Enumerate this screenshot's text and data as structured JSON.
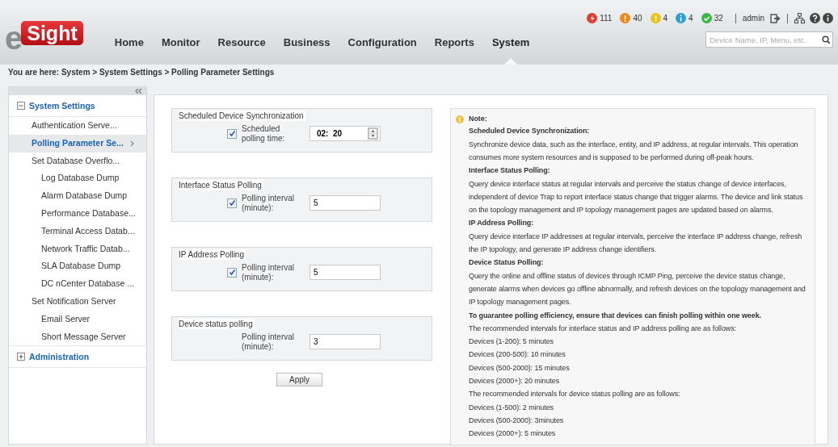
{
  "logo": {
    "prefix": "e",
    "name": "Sight"
  },
  "nav": [
    {
      "label": "Home",
      "selected": false
    },
    {
      "label": "Monitor",
      "selected": false
    },
    {
      "label": "Resource",
      "selected": false
    },
    {
      "label": "Business",
      "selected": false
    },
    {
      "label": "Configuration",
      "selected": false
    },
    {
      "label": "Reports",
      "selected": false
    },
    {
      "label": "System",
      "selected": true
    }
  ],
  "alarms": [
    {
      "kind": "critical",
      "color": "#e03c31",
      "count": "111"
    },
    {
      "kind": "major",
      "color": "#f08a1c",
      "count": "40"
    },
    {
      "kind": "minor",
      "color": "#e8c31c",
      "count": "4"
    },
    {
      "kind": "warning",
      "color": "#2a9fd8",
      "count": "4"
    },
    {
      "kind": "cleared",
      "color": "#3bb54a",
      "count": "32"
    }
  ],
  "user": "admin",
  "search": {
    "placeholder": "Device Name, IP, Menu, etc."
  },
  "breadcrumb": "You are here: System > System Settings > Polling Parameter Settings",
  "sidebar": [
    {
      "label": "System Settings",
      "expanded": true,
      "children": [
        {
          "label": "Authentication Serve...",
          "selected": false
        },
        {
          "label": "Polling Parameter Se...",
          "selected": true
        },
        {
          "label": "Set Database Overflo...",
          "selected": false,
          "children": [
            {
              "label": "Log Database Dump",
              "selected": false
            },
            {
              "label": "Alarm Database Dump",
              "selected": false
            },
            {
              "label": "Performance Database...",
              "selected": false
            },
            {
              "label": "Terminal Access Datab...",
              "selected": false
            },
            {
              "label": "Network Traffic Datab...",
              "selected": false
            },
            {
              "label": "SLA Database Dump",
              "selected": false
            },
            {
              "label": "DC nCenter Database ...",
              "selected": false
            }
          ]
        },
        {
          "label": "Set Notification Server",
          "selected": false,
          "children": [
            {
              "label": "Email Server",
              "selected": false
            },
            {
              "label": "Short Message Server",
              "selected": false
            }
          ]
        }
      ]
    },
    {
      "label": "Administration",
      "expanded": false
    }
  ],
  "groups": [
    {
      "title": "Scheduled Device Synchronization",
      "checked": true,
      "label": "Scheduled polling time:",
      "kind": "spinner",
      "value": "02:  20"
    },
    {
      "title": "Interface Status Polling",
      "checked": true,
      "label": "Polling interval (minute):",
      "kind": "text",
      "value": "5"
    },
    {
      "title": "IP Address Polling",
      "checked": true,
      "label": "Polling interval (minute):",
      "kind": "text",
      "value": "5"
    },
    {
      "title": "Device status polling",
      "label": "Polling interval (minute):",
      "kind": "text",
      "value": "3"
    }
  ],
  "apply": "Apply",
  "note": {
    "title": "Note:",
    "items": [
      {
        "kind": "heading",
        "text": "Scheduled Device Synchronization:"
      },
      {
        "kind": "text",
        "text": "Synchronize device data, such as the interface, entity, and IP address, at regular intervals. This operation consumes more system resources and is supposed to be performed during off-peak hours."
      },
      {
        "kind": "heading",
        "text": "Interface Status Polling:"
      },
      {
        "kind": "text",
        "text": "Query device interface status at regular intervals and perceive the status change of device interfaces, independent of device Trap to report interface status change that trigger alarms. The device and link status on the topology management and IP topology management pages are updated based on alarms."
      },
      {
        "kind": "heading",
        "text": "IP Address Polling:"
      },
      {
        "kind": "text",
        "text": "Query device interface IP addresses at regular intervals, perceive the interface IP address change, refresh the IP topology, and generate IP address change identifiers."
      },
      {
        "kind": "heading",
        "text": "Device Status Polling:"
      },
      {
        "kind": "text",
        "text": "Query the online and offline status of devices through ICMP Ping, perceive the device status change, generate alarms when devices go offline abnormally, and refresh devices on the topology management and IP topology management pages."
      },
      {
        "kind": "heading",
        "text": "To guarantee polling efficiency, ensure that devices can finish polling within one week."
      },
      {
        "kind": "text",
        "text": "The recommended intervals for interface status and IP address polling are as follows:"
      },
      {
        "kind": "text",
        "text": "Devices (1-200): 5 minutes"
      },
      {
        "kind": "text",
        "text": "Devices (200-500): 10 minutes"
      },
      {
        "kind": "text",
        "text": "Devices (500-2000): 15 minutes"
      },
      {
        "kind": "text",
        "text": "Devices (2000+): 20 minutes"
      },
      {
        "kind": "text",
        "text": "The recommended intervals for device status polling are as follows:"
      },
      {
        "kind": "text",
        "text": "Devices (1-500): 2 minutes"
      },
      {
        "kind": "text",
        "text": "Devices (500-2000): 3minutes"
      },
      {
        "kind": "text",
        "text": "Devices (2000+): 5 minutes"
      }
    ]
  }
}
